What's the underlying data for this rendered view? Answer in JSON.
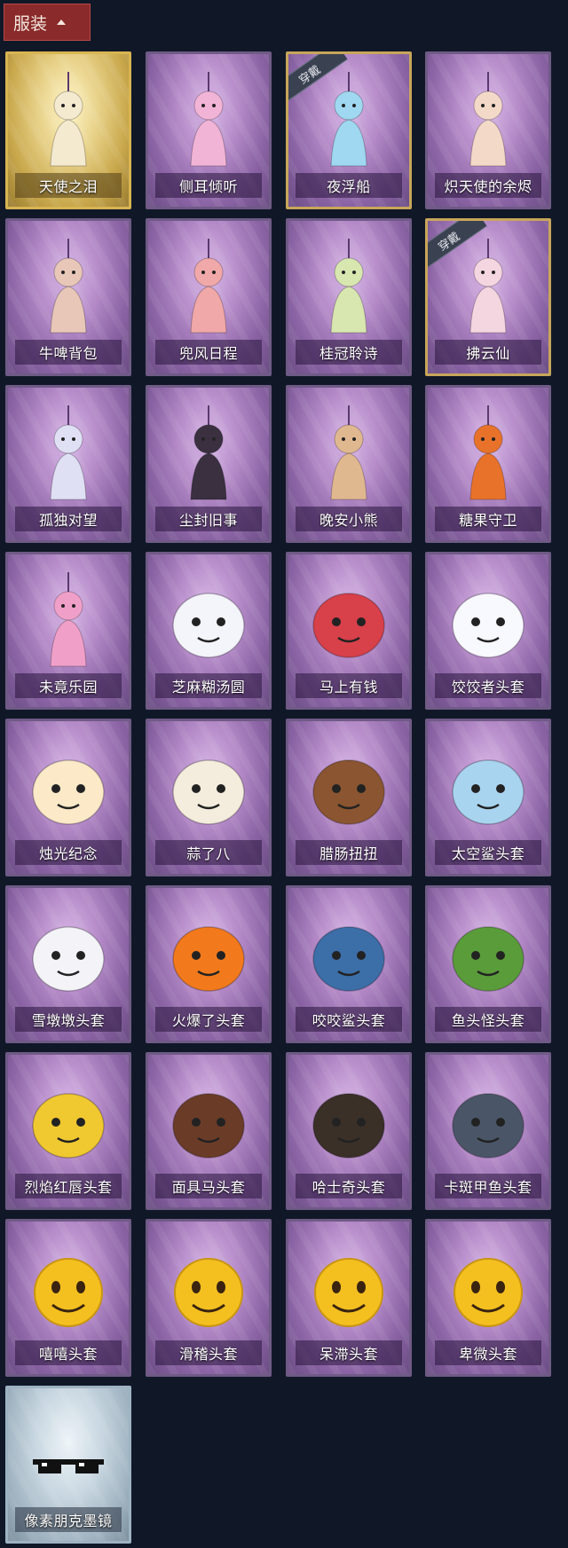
{
  "header": {
    "label": "服装"
  },
  "badge_text": "穿戴",
  "items": [
    {
      "name": "天使之泪",
      "theme": "gold",
      "icon": "angel-figure-icon",
      "art_color": "#f4ead0",
      "equipped": false
    },
    {
      "name": "侧耳倾听",
      "theme": "purple",
      "icon": "flower-wreath-icon",
      "art_color": "#f2b4d6",
      "equipped": false
    },
    {
      "name": "夜浮船",
      "theme": "purple",
      "icon": "jellyfish-charm-icon",
      "art_color": "#9fd8f0",
      "equipped": true
    },
    {
      "name": "炽天使的余烬",
      "theme": "purple",
      "icon": "angel-doll-icon",
      "art_color": "#f3d9c8",
      "equipped": false
    },
    {
      "name": "牛啤背包",
      "theme": "purple",
      "icon": "cow-barrel-icon",
      "art_color": "#e8c7b8",
      "equipped": false
    },
    {
      "name": "兜风日程",
      "theme": "purple",
      "icon": "cap-doll-icon",
      "art_color": "#f0a8a8",
      "equipped": false
    },
    {
      "name": "桂冠聆诗",
      "theme": "purple",
      "icon": "laurel-doll-icon",
      "art_color": "#d8e6b0",
      "equipped": false
    },
    {
      "name": "拂云仙",
      "theme": "purple",
      "icon": "fairy-charm-icon",
      "art_color": "#f4d6e0",
      "equipped": true
    },
    {
      "name": "孤独对望",
      "theme": "purple",
      "icon": "silver-doll-icon",
      "art_color": "#dfe0f4",
      "equipped": false
    },
    {
      "name": "尘封旧事",
      "theme": "purple",
      "icon": "crowned-doll-icon",
      "art_color": "#3a3040",
      "equipped": false
    },
    {
      "name": "晚安小熊",
      "theme": "purple",
      "icon": "bear-charm-icon",
      "art_color": "#e0b890",
      "equipped": false
    },
    {
      "name": "糖果守卫",
      "theme": "purple",
      "icon": "pumpkin-charm-icon",
      "art_color": "#e8722a",
      "equipped": false
    },
    {
      "name": "未竟乐园",
      "theme": "purple",
      "icon": "jester-doll-icon",
      "art_color": "#f0a0c8",
      "equipped": false
    },
    {
      "name": "芝麻糊汤圆",
      "theme": "purple",
      "icon": "dumpling-mask-icon",
      "art_color": "#f4f4fb",
      "equipped": false
    },
    {
      "name": "马上有钱",
      "theme": "purple",
      "icon": "horse-mask-icon",
      "art_color": "#d8404a",
      "equipped": false
    },
    {
      "name": "饺饺者头套",
      "theme": "purple",
      "icon": "cloud-mask-icon",
      "art_color": "#f8f8ff",
      "equipped": false
    },
    {
      "name": "烛光纪念",
      "theme": "purple",
      "icon": "candle-mask-icon",
      "art_color": "#fbe9c8",
      "equipped": false
    },
    {
      "name": "蒜了八",
      "theme": "purple",
      "icon": "garlic-mask-icon",
      "art_color": "#f4ecdc",
      "equipped": false
    },
    {
      "name": "腊肠扭扭",
      "theme": "purple",
      "icon": "dachshund-mask-icon",
      "art_color": "#8a5530",
      "equipped": false
    },
    {
      "name": "太空鲨头套",
      "theme": "purple",
      "icon": "space-shark-mask-icon",
      "art_color": "#a9d4f0",
      "equipped": false
    },
    {
      "name": "雪墩墩头套",
      "theme": "purple",
      "icon": "snowman-mask-icon",
      "art_color": "#f4f4f8",
      "equipped": false
    },
    {
      "name": "火爆了头套",
      "theme": "purple",
      "icon": "fire-mask-icon",
      "art_color": "#f27a1c",
      "equipped": false
    },
    {
      "name": "咬咬鲨头套",
      "theme": "purple",
      "icon": "shark-mask-icon",
      "art_color": "#3c6ea8",
      "equipped": false
    },
    {
      "name": "鱼头怪头套",
      "theme": "purple",
      "icon": "fish-mask-icon",
      "art_color": "#5a9c3a",
      "equipped": false
    },
    {
      "name": "烈焰红唇头套",
      "theme": "purple",
      "icon": "yellow-mask-icon",
      "art_color": "#f0c830",
      "equipped": false
    },
    {
      "name": "面具马头套",
      "theme": "purple",
      "icon": "horse-head-mask-icon",
      "art_color": "#6a3c28",
      "equipped": false
    },
    {
      "name": "哈士奇头套",
      "theme": "purple",
      "icon": "husky-mask-icon",
      "art_color": "#3a3028",
      "equipped": false
    },
    {
      "name": "卡斑甲鱼头套",
      "theme": "purple",
      "icon": "whale-mask-icon",
      "art_color": "#4a5668",
      "equipped": false
    },
    {
      "name": "嘻嘻头套",
      "theme": "purple",
      "icon": "grin-emoji-mask-icon",
      "art_color": "#f4c020",
      "equipped": false
    },
    {
      "name": "滑稽头套",
      "theme": "purple",
      "icon": "smirk-emoji-mask-icon",
      "art_color": "#f4c020",
      "equipped": false
    },
    {
      "name": "呆滞头套",
      "theme": "purple",
      "icon": "dazed-emoji-mask-icon",
      "art_color": "#f4c020",
      "equipped": false
    },
    {
      "name": "卑微头套",
      "theme": "purple",
      "icon": "sad-emoji-mask-icon",
      "art_color": "#f4c020",
      "equipped": false
    },
    {
      "name": "像素朋克墨镜",
      "theme": "silver",
      "icon": "pixel-sunglasses-icon",
      "art_color": "#111111",
      "equipped": false
    }
  ]
}
